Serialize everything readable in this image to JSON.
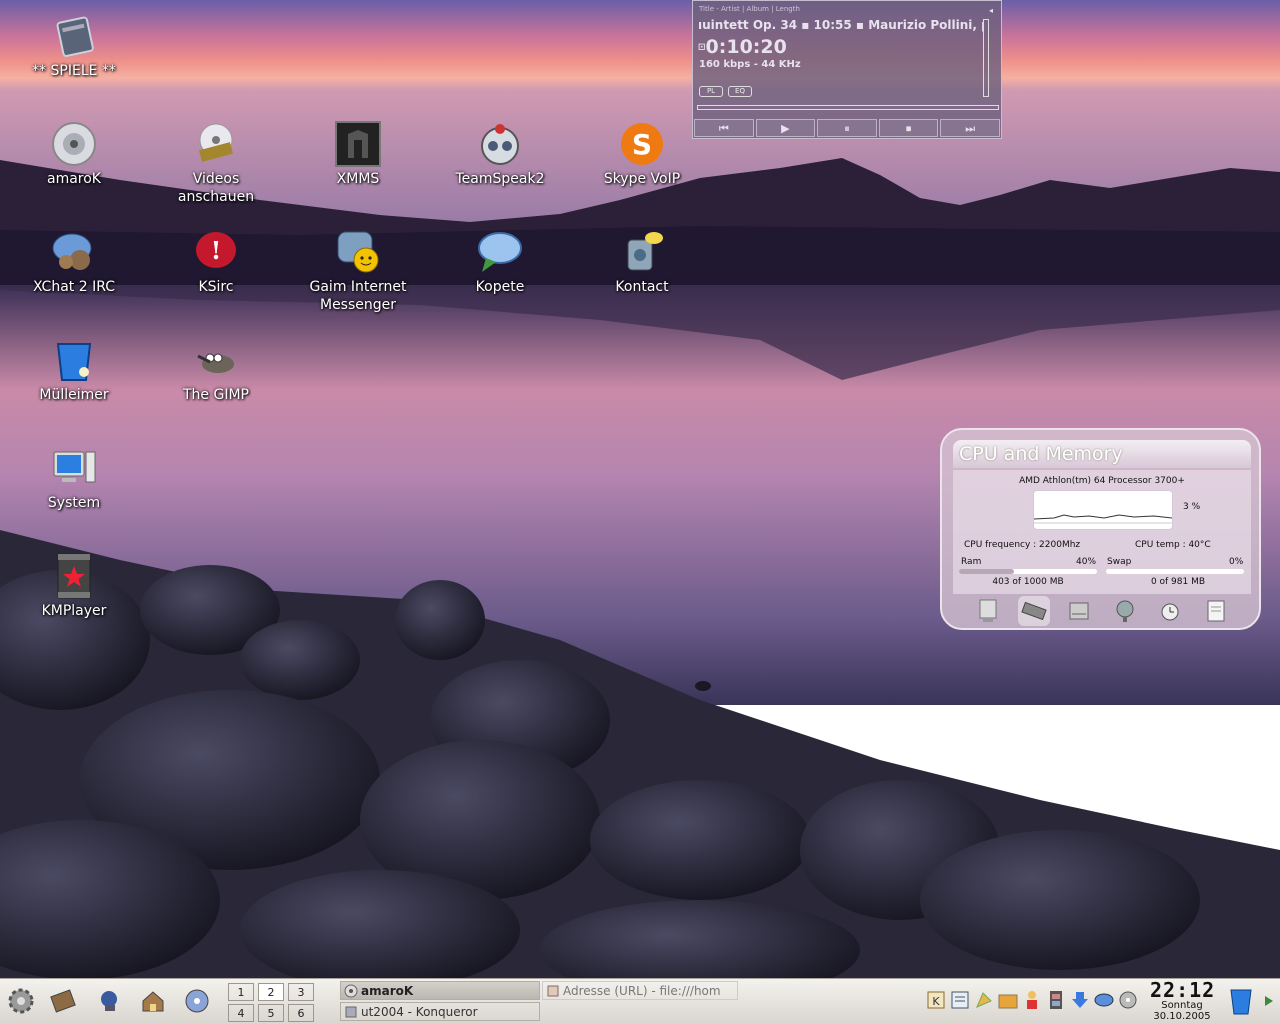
{
  "desktop": {
    "icons": [
      {
        "label": "** SPIELE **"
      },
      {
        "label": "amaroK"
      },
      {
        "label": "Videos\nanschauen"
      },
      {
        "label": "XMMS"
      },
      {
        "label": "TeamSpeak2"
      },
      {
        "label": "Skype VoIP"
      },
      {
        "label": "XChat 2 IRC"
      },
      {
        "label": "KSirc"
      },
      {
        "label": "Gaim Internet\nMessenger"
      },
      {
        "label": "Kopete"
      },
      {
        "label": "Kontact"
      },
      {
        "label": "Mülleimer"
      },
      {
        "label": "The GIMP"
      },
      {
        "label": "System"
      },
      {
        "label": "KMPlayer"
      }
    ]
  },
  "player": {
    "header": "Title - Artist | Album | Length",
    "title_scroll": "ıuintett Op. 34  ▪  10:55  ▪  Maurizio Pollini, p",
    "time": "0:10:20",
    "bitrate": "160 kbps - 44 KHz",
    "pl_label": "PL",
    "eq_label": "EQ",
    "controls": [
      "⏮",
      "▶",
      "⏸",
      "⏹",
      "⏭"
    ]
  },
  "cpu_widget": {
    "title": "CPU and Memory",
    "processor": "AMD Athlon(tm) 64 Processor 3700+",
    "cpu_percent": "3 %",
    "cpu_frequency": "CPU frequency : 2200Mhz",
    "cpu_temp": "CPU temp : 40°C",
    "ram_label": "Ram",
    "ram_percent": "40%",
    "ram_fraction": 0.4,
    "ram_value": "403 of 1000 MB",
    "swap_label": "Swap",
    "swap_percent": "0%",
    "swap_fraction": 0.0,
    "swap_value": "0 of 981 MB"
  },
  "taskbar": {
    "pager": [
      "1",
      "2",
      "3",
      "4",
      "5",
      "6"
    ],
    "active_desktop": "2",
    "tasks": [
      {
        "label": "amaroK",
        "active": true
      },
      {
        "label": "ut2004 - Konqueror",
        "active": false
      }
    ],
    "address_label": "Adresse (URL) - file:///hom",
    "clock_time": "22:12",
    "clock_day": "Sonntag",
    "clock_date": "30.10.2005"
  }
}
